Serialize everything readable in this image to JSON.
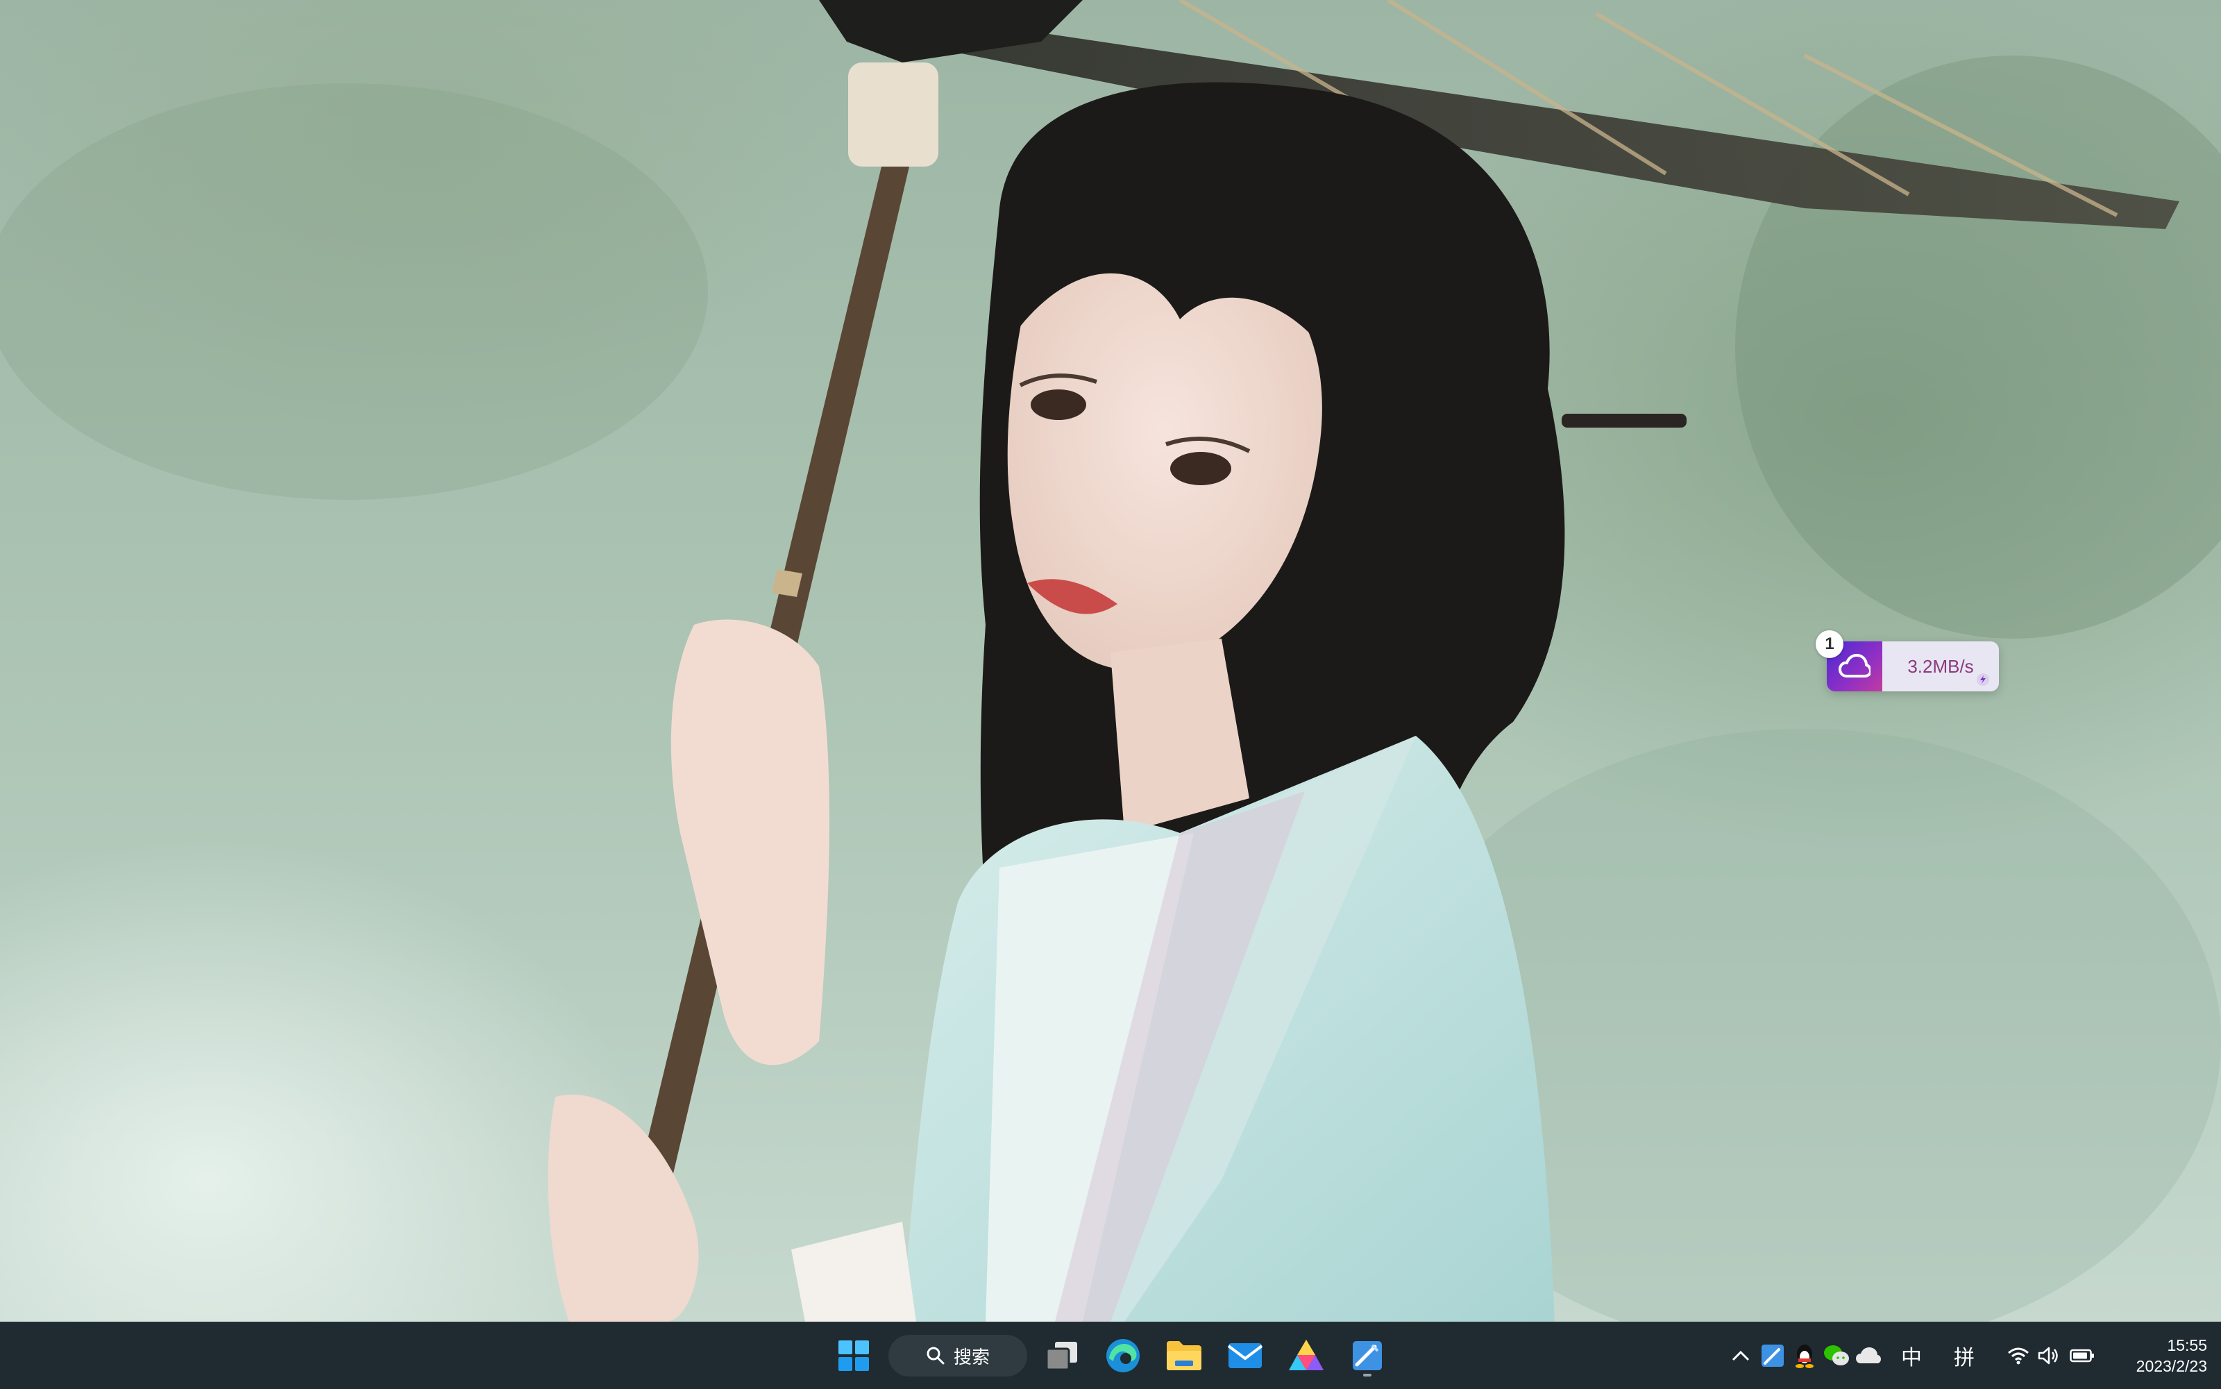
{
  "desktop": {
    "wallpaper_icon": "portrait-photo-woman-with-paper-umbrella",
    "speed_widget": {
      "badge_count": "1",
      "speed": "3.2MB/s",
      "icon": "cloud-icon",
      "accent": "#8a2fc7"
    }
  },
  "taskbar": {
    "start_icon": "windows-start-icon",
    "search_label": "搜索",
    "pinned": [
      {
        "name": "task-view",
        "icon": "task-view-icon"
      },
      {
        "name": "edge",
        "icon": "edge-browser-icon"
      },
      {
        "name": "file-explorer",
        "icon": "folder-icon"
      },
      {
        "name": "mail",
        "icon": "mail-icon"
      },
      {
        "name": "app-a",
        "icon": "triangle-app-icon"
      },
      {
        "name": "app-blue",
        "icon": "blue-app-icon"
      }
    ],
    "tray": {
      "chevron_icon": "chevron-up-icon",
      "icons": [
        "blue-app-tray-icon",
        "qq-penguin-icon",
        "wechat-icon",
        "onedrive-cloud-icon"
      ],
      "ime_mode": "中",
      "ime_layout": "拼",
      "wifi_icon": "wifi-icon",
      "volume_icon": "volume-icon",
      "battery_icon": "battery-icon"
    },
    "clock": {
      "time": "15:55",
      "date": "2023/2/23"
    }
  }
}
